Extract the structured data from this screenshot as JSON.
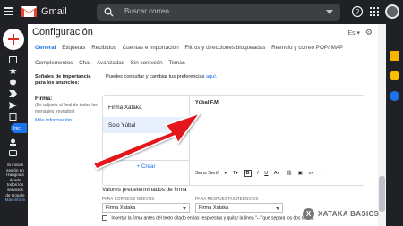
{
  "app": {
    "name": "Gmail"
  },
  "search": {
    "placeholder": "Buscar correo"
  },
  "page": {
    "title": "Configuración",
    "lang_button": "Es"
  },
  "tabs_row1": [
    "General",
    "Etiquetas",
    "Recibidos",
    "Cuentas e importación",
    "Filtros y direcciones bloqueadas",
    "Reenvío y correo POP/IMAP"
  ],
  "tabs_row2": [
    "Complementos",
    "Chat",
    "Avanzadas",
    "Sin conexión",
    "Temas"
  ],
  "importance": {
    "label": "Señales de importancia para los anuncios:",
    "text": "Puedes consultar y cambiar tus preferencias",
    "link": "aquí."
  },
  "firma": {
    "label": "Firma:",
    "desc": "(Se adjunta al final de todos los mensajes enviados)",
    "link": "Más información",
    "signatures": [
      "Firma Xataka",
      "Solo Yúbal"
    ],
    "selected_name": "Yúbal F.M.",
    "font": "Sans Serif",
    "create_button": "Crear"
  },
  "defaults": {
    "title": "Valores predeterminados de firma",
    "new_label": "PARA CORREOS NUEVOS",
    "reply_label": "PARA RESPUESTAS/REENVÍOS",
    "new_value": "Firma Xataka",
    "reply_value": "Firma Xataka",
    "checkbox_text": "Insertar la firma antes del texto citado en las respuestas y quitar la línea \"--\" que separa los dos textos."
  },
  "sidebar": {
    "badge": "Inici",
    "hangouts_text": "Si inicias sesión en Hangouts desde todos los servicios de Google",
    "hangouts_link": "Más inform"
  },
  "watermark": "XATAKA BASICS",
  "colors": {
    "accent": "#1a73e8",
    "dark_bg": "#202124",
    "arrow": "#d93025"
  }
}
